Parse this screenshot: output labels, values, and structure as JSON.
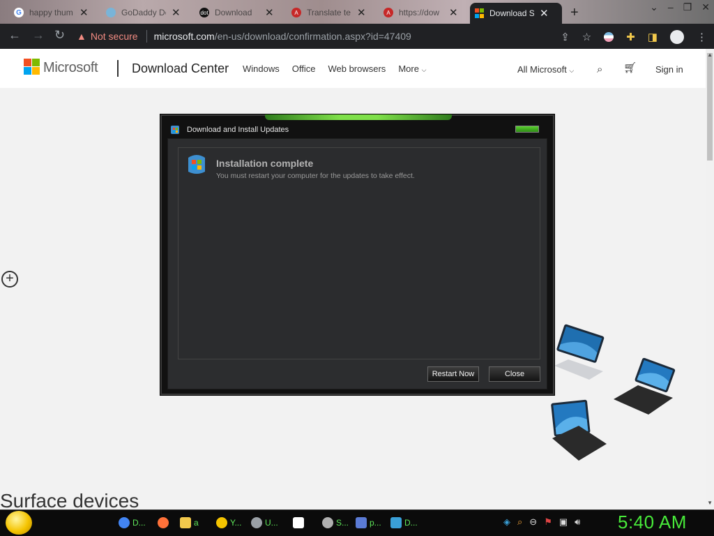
{
  "tabs": [
    {
      "label": "happy thum",
      "favicon_color": "#ffffff",
      "favicon_text": "G"
    },
    {
      "label": "GoDaddy De",
      "favicon_color": "#79b4d8",
      "favicon_text": ""
    },
    {
      "label": "Download",
      "favicon_color": "#111111",
      "favicon_text": "dot"
    },
    {
      "label": "Translate te",
      "favicon_color": "#c62828",
      "favicon_text": "A"
    },
    {
      "label": "https://dow",
      "favicon_color": "#c62828",
      "favicon_text": "A"
    },
    {
      "label": "Download S",
      "favicon_color": "#f25022",
      "favicon_text": ""
    }
  ],
  "new_tab": "+",
  "address": {
    "warning": "Not secure",
    "host": "microsoft.com",
    "path": "/en-us/download/confirmation.aspx?id=47409"
  },
  "site": {
    "brand": "Microsoft",
    "section": "Download Center",
    "nav": [
      "Windows",
      "Office",
      "Web browsers",
      "More"
    ],
    "all_microsoft": "All Microsoft",
    "sign_in": "Sign in",
    "heading": "Surface devices"
  },
  "dialog": {
    "title": "Download and Install Updates",
    "heading": "Installation complete",
    "message": "You must restart your computer for the updates to take effect.",
    "restart_label": "Restart Now",
    "close_label": "Close"
  },
  "taskbar": {
    "items": [
      {
        "label": "D...",
        "icon_color": "#4285f4"
      },
      {
        "label": "",
        "icon_color": "#ff7139"
      },
      {
        "label": "a",
        "icon_color": "#f2c94c"
      },
      {
        "label": "Y...",
        "icon_color": "#f5c400"
      },
      {
        "label": "U...",
        "icon_color": "#9aa0a6"
      },
      {
        "label": "",
        "icon_color": "#ffffff"
      },
      {
        "label": "S...",
        "icon_color": "#b0b0b0"
      },
      {
        "label": "p...",
        "icon_color": "#5b7bd5"
      },
      {
        "label": "D...",
        "icon_color": "#3aa0d8"
      }
    ],
    "clock": "5:40 AM"
  },
  "colors": {
    "accent_green": "#48ea3a",
    "warning_red": "#f28b82"
  }
}
